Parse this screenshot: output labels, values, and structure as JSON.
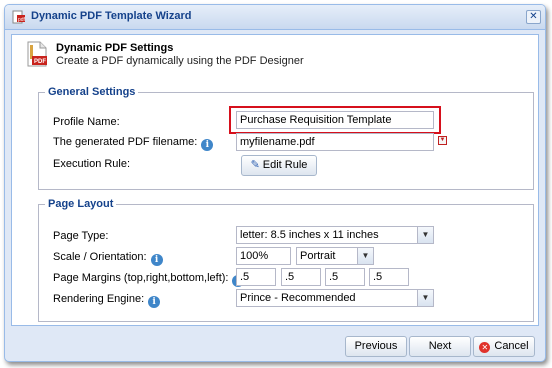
{
  "window": {
    "title": "Dynamic PDF Template Wizard",
    "close_glyph": "✕"
  },
  "header": {
    "title": "Dynamic PDF Settings",
    "subtitle": "Create a PDF dynamically using the PDF Designer",
    "icon": "pdf-document-icon"
  },
  "general": {
    "legend": "General Settings",
    "profile_name_label": "Profile Name:",
    "profile_name_value": "Purchase Requisition Template",
    "filename_label": "The generated PDF filename:",
    "filename_value": "myfilename.pdf",
    "execution_rule_label": "Execution Rule:",
    "edit_rule_label": "Edit Rule"
  },
  "layout": {
    "legend": "Page Layout",
    "page_type_label": "Page Type:",
    "page_type_value": "letter: 8.5 inches x 11 inches",
    "scale_label": "Scale / Orientation:",
    "scale_value": "100%",
    "orientation_value": "Portrait",
    "margins_label": "Page Margins (top,right,bottom,left):",
    "margins": [
      ".5",
      ".5",
      ".5",
      ".5"
    ],
    "engine_label": "Rendering Engine:",
    "engine_value": "Prince - Recommended"
  },
  "footer": {
    "previous": "Previous",
    "next": "Next",
    "cancel": "Cancel"
  },
  "colors": {
    "highlight": "#d6101c",
    "accent": "#15428b"
  }
}
